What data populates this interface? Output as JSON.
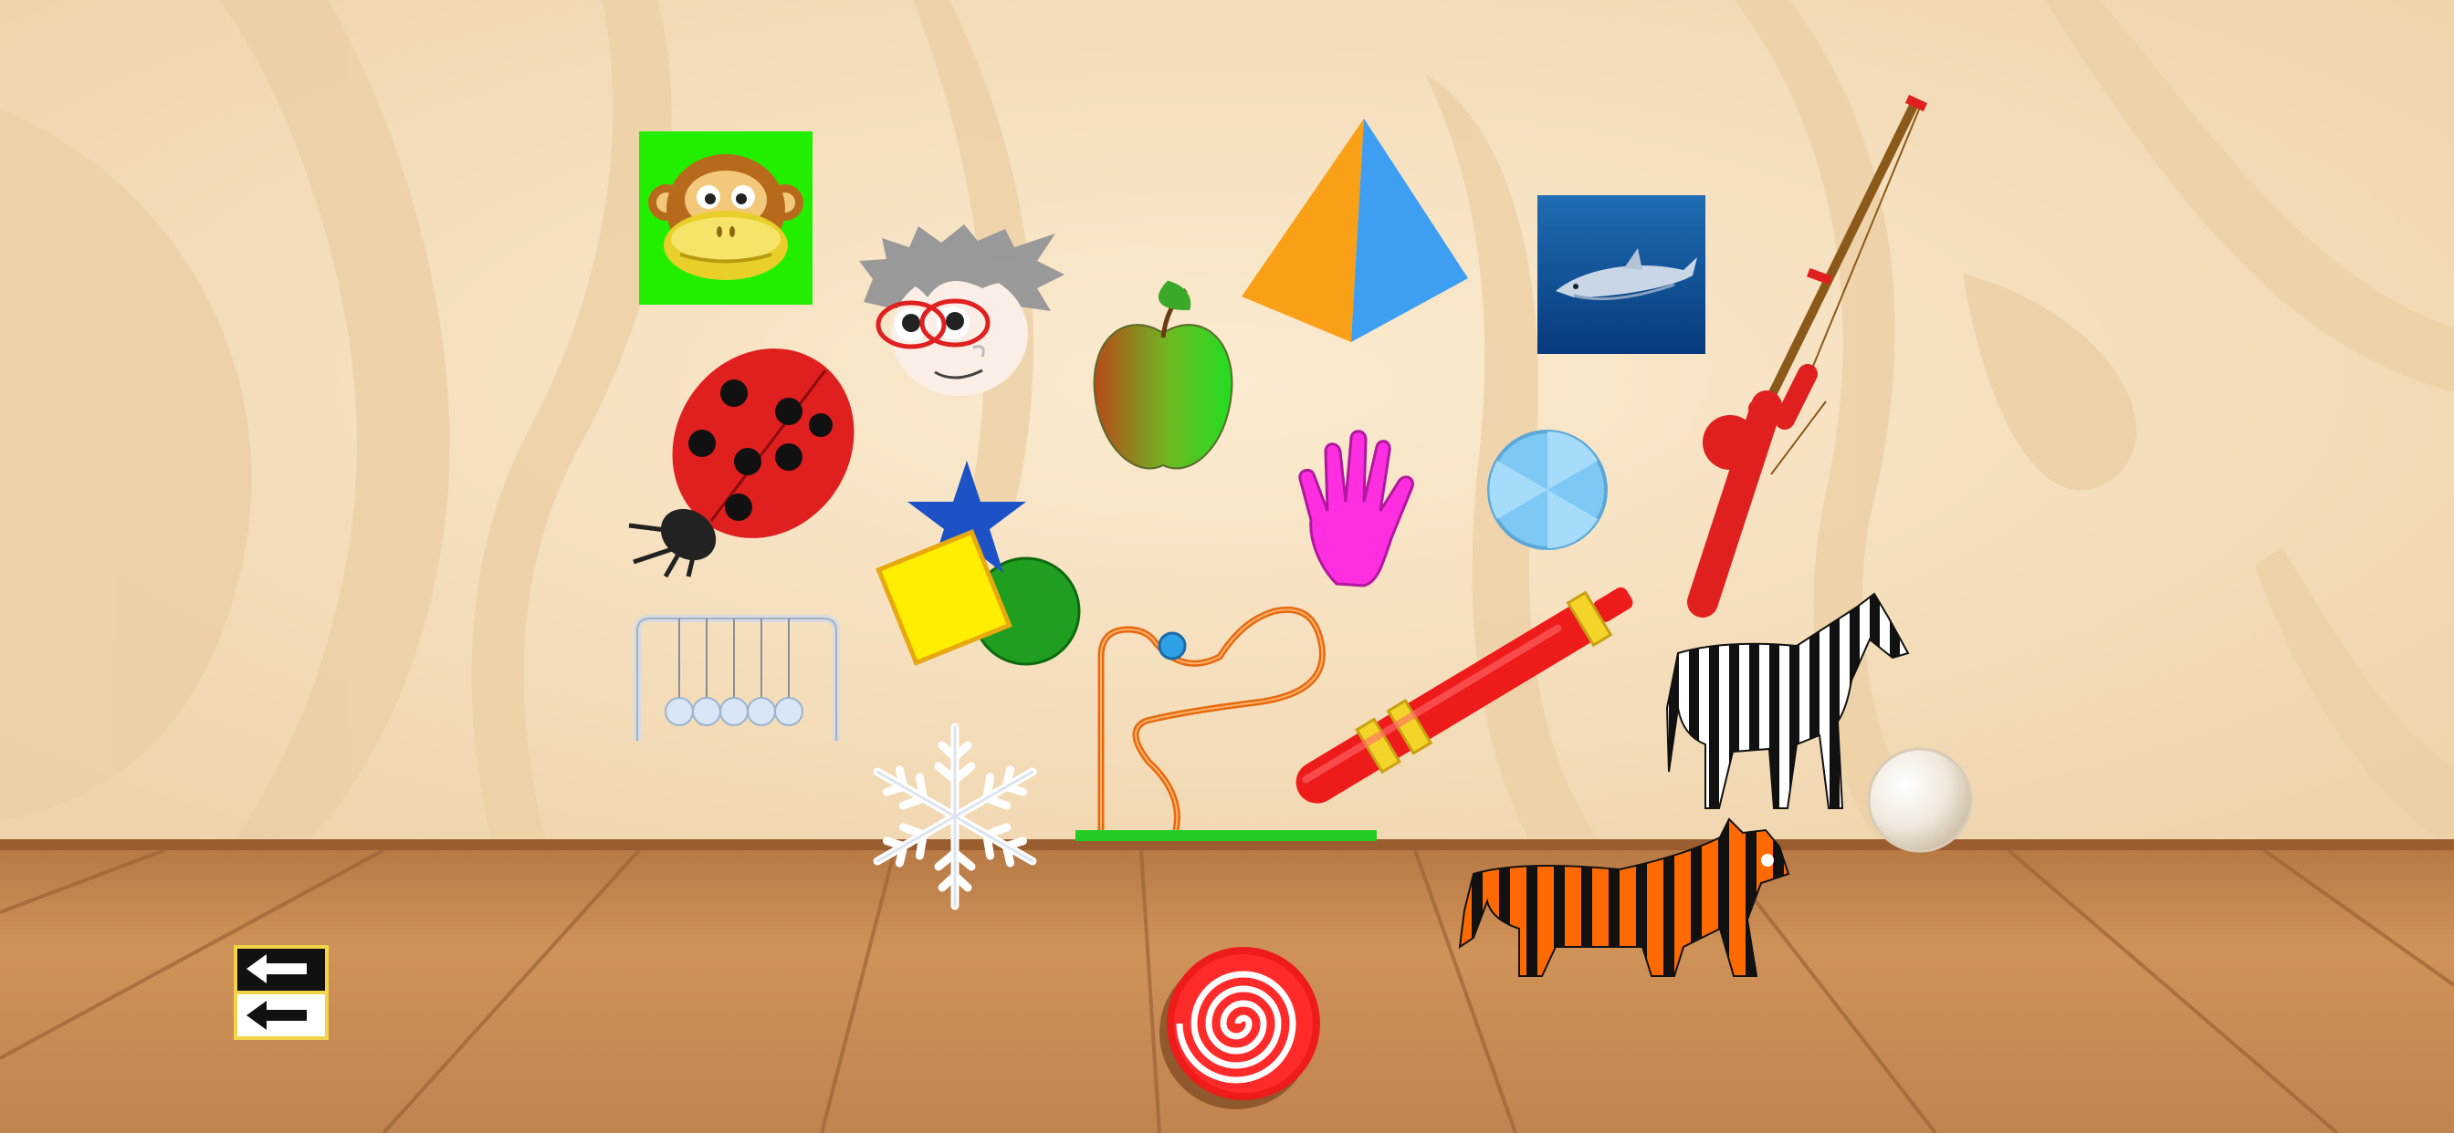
{
  "game": {
    "screen": "object-sorting-playroom",
    "objects": [
      {
        "id": "monkey",
        "icon": "monkey-face-icon"
      },
      {
        "id": "grandma",
        "icon": "grandma-face-icon"
      },
      {
        "id": "pyramid",
        "icon": "pyramid-icon"
      },
      {
        "id": "dolphin",
        "icon": "dolphin-photo-icon"
      },
      {
        "id": "fishing-rod",
        "icon": "fishing-rod-icon"
      },
      {
        "id": "apple",
        "icon": "apple-icon"
      },
      {
        "id": "ladybug",
        "icon": "ladybug-icon"
      },
      {
        "id": "hand",
        "icon": "hand-icon"
      },
      {
        "id": "blue-ball",
        "icon": "blue-ball-icon"
      },
      {
        "id": "shapes-toy",
        "icon": "shape-stack-icon"
      },
      {
        "id": "newtons-cradle",
        "icon": "newtons-cradle-icon"
      },
      {
        "id": "bead-maze",
        "icon": "bead-maze-icon"
      },
      {
        "id": "pen",
        "icon": "pen-icon"
      },
      {
        "id": "zebra",
        "icon": "zebra-icon"
      },
      {
        "id": "pearl",
        "icon": "pearl-icon"
      },
      {
        "id": "snowflake",
        "icon": "snowflake-icon"
      },
      {
        "id": "tiger",
        "icon": "tiger-icon"
      },
      {
        "id": "lollipop",
        "icon": "lollipop-icon"
      }
    ],
    "back_button": {
      "icon": "back-arrows-icon"
    }
  },
  "colors": {
    "wall": "#f5dfbd",
    "wall_stripe": "#eccfa5",
    "floor": "#c9894f",
    "floor_dark": "#a8683a",
    "monkey_bg": "#22ee00",
    "pyramid_left": "#f9a016",
    "pyramid_right": "#3e9ef2",
    "ladybug": "#e01f1f",
    "hand": "#ff2ee0",
    "pen": "#ee1b1b",
    "tiger": "#ff6a00",
    "maze_base": "#22cc22"
  }
}
